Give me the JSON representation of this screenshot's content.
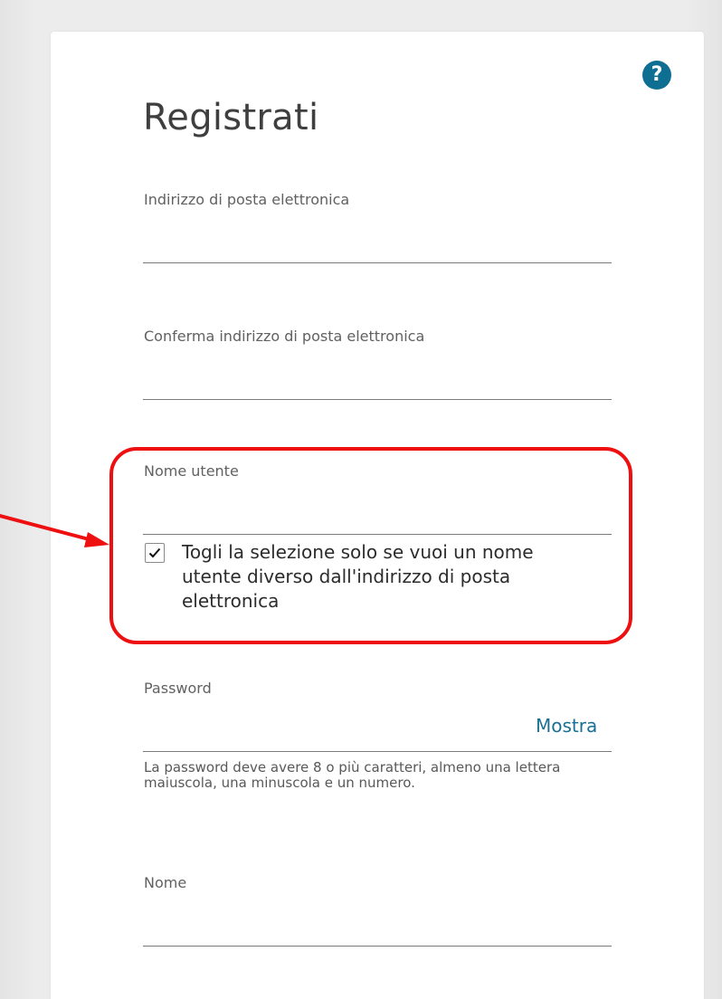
{
  "page": {
    "title": "Registrati",
    "help_icon": "?"
  },
  "form": {
    "email": {
      "label": "Indirizzo di posta elettronica",
      "value": ""
    },
    "confirm_email": {
      "label": "Conferma indirizzo di posta elettronica",
      "value": ""
    },
    "username": {
      "label": "Nome utente",
      "value": "",
      "checkbox_checked": true,
      "checkbox_label": "Togli la selezione solo se vuoi un nome utente diverso dall'indirizzo di posta elettronica"
    },
    "password": {
      "label": "Password",
      "value": "",
      "show_label": "Mostra",
      "hint": "La password deve avere 8 o più caratteri, almeno una lettera maiuscola, una minuscola e un numero."
    },
    "first_name": {
      "label": "Nome",
      "value": ""
    }
  },
  "colors": {
    "annotation": "#ee1010",
    "accent": "#1b6f95",
    "help_icon_bg": "#0f6f93"
  }
}
